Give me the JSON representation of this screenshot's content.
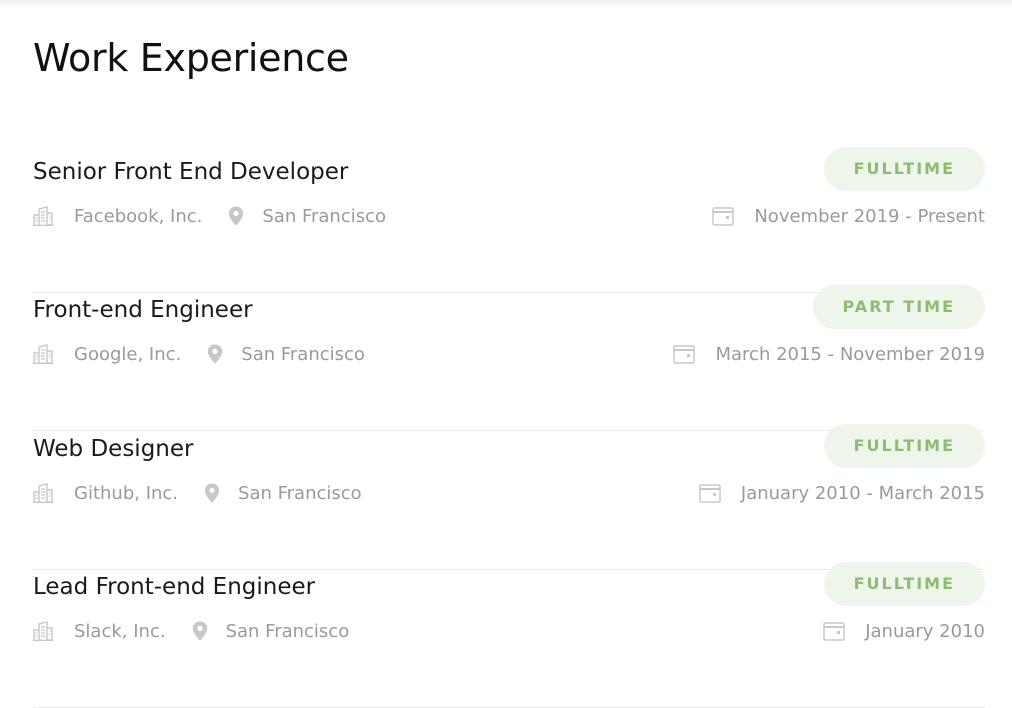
{
  "section": {
    "title": "Work Experience"
  },
  "colors": {
    "badge_bg": "#eef5ea",
    "badge_text": "#8dbd72",
    "muted_text": "#9a9a9a",
    "divider": "#ececec"
  },
  "icons": {
    "company": "building-icon",
    "location": "map-pin-icon",
    "dates": "calendar-icon"
  },
  "jobs": [
    {
      "title": "Senior Front End Developer",
      "company": "Facebook, Inc.",
      "location": "San Francisco",
      "type": "FULLTIME",
      "dates": "November 2019 - Present"
    },
    {
      "title": "Front-end Engineer",
      "company": "Google, Inc.",
      "location": "San Francisco",
      "type": "PART TIME",
      "dates": "March 2015 - November 2019"
    },
    {
      "title": "Web Designer",
      "company": "Github, Inc.",
      "location": "San Francisco",
      "type": "FULLTIME",
      "dates": "January 2010 - March 2015"
    },
    {
      "title": "Lead Front-end Engineer",
      "company": "Slack, Inc.",
      "location": "San Francisco",
      "type": "FULLTIME",
      "dates": "January 2010"
    }
  ]
}
